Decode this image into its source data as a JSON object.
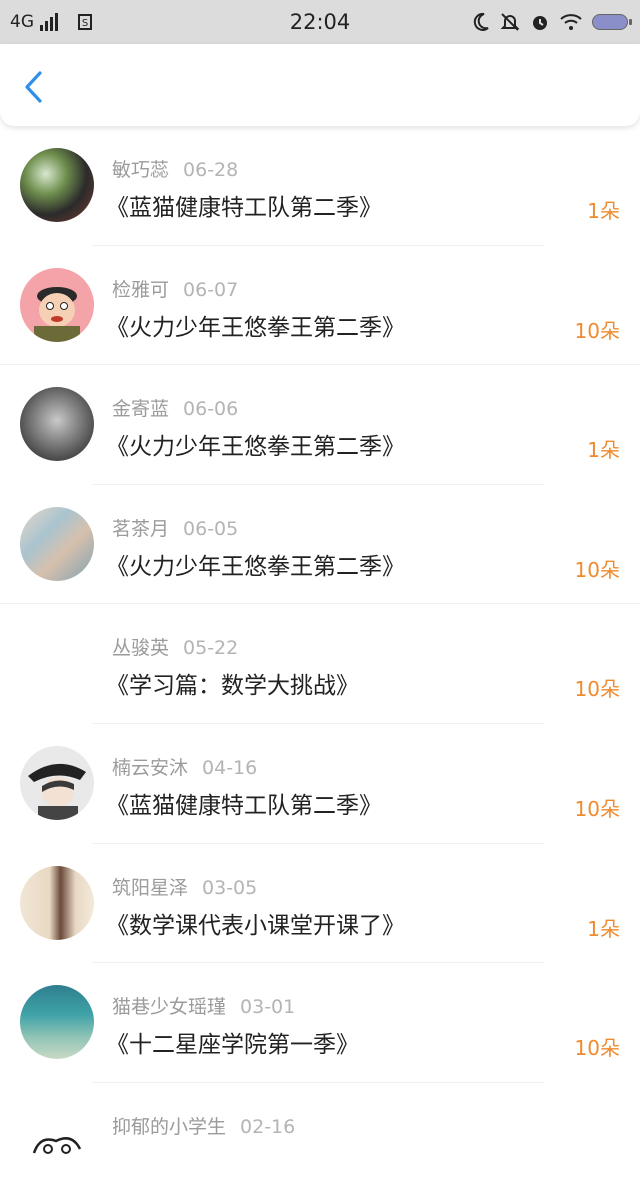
{
  "status_bar": {
    "network": "4G",
    "time": "22:04"
  },
  "nav": {
    "back_icon": "chevron-left-icon",
    "accent_color": "#2f8fe8"
  },
  "list": [
    {
      "name": "敏巧蕊",
      "date": "06-28",
      "title": "《蓝猫健康特工队第二季》",
      "amount": "1朵",
      "avatar": "photo"
    },
    {
      "name": "检雅可",
      "date": "06-07",
      "title": "《火力少年王悠拳王第二季》",
      "amount": "10朵",
      "avatar": "cartoon"
    },
    {
      "name": "金寄蓝",
      "date": "06-06",
      "title": "《火力少年王悠拳王第二季》",
      "amount": "1朵",
      "avatar": "lion"
    },
    {
      "name": "茗茶月",
      "date": "06-05",
      "title": "《火力少年王悠拳王第二季》",
      "amount": "10朵",
      "avatar": "pastel"
    },
    {
      "name": "丛骏英",
      "date": "05-22",
      "title": "《学习篇：数学大挑战》",
      "amount": "10朵",
      "avatar": "none"
    },
    {
      "name": "楠云安沐",
      "date": "04-16",
      "title": "《蓝猫健康特工队第二季》",
      "amount": "10朵",
      "avatar": "anime"
    },
    {
      "name": "筑阳星泽",
      "date": "03-05",
      "title": "《数学课代表小课堂开课了》",
      "amount": "1朵",
      "avatar": "warm"
    },
    {
      "name": "猫巷少女瑶瑾",
      "date": "03-01",
      "title": "《十二星座学院第一季》",
      "amount": "10朵",
      "avatar": "teal"
    },
    {
      "name": "抑郁的小学生",
      "date": "02-16",
      "title": "",
      "amount": "",
      "avatar": "sketch"
    }
  ],
  "colors": {
    "amount": "#f08a2e",
    "name": "#9b9b9b",
    "title": "#222222"
  }
}
